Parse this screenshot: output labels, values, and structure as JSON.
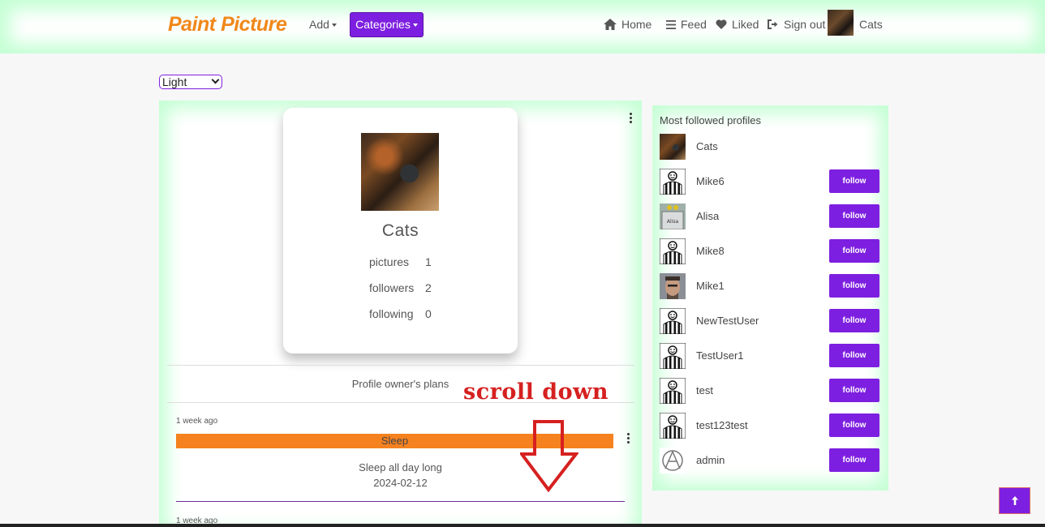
{
  "navbar": {
    "brand": "Paint Picture",
    "add_label": "Add",
    "categories_label": "Categories",
    "home_label": "Home",
    "feed_label": "Feed",
    "liked_label": "Liked",
    "signout_label": "Sign out",
    "user_label": "Cats"
  },
  "theme_select": {
    "selected": "Light"
  },
  "profile": {
    "name": "Cats",
    "stats": [
      {
        "label": "pictures",
        "value": "1"
      },
      {
        "label": "followers",
        "value": "2"
      },
      {
        "label": "following",
        "value": "0"
      }
    ]
  },
  "plans": {
    "title": "Profile owner's plans",
    "items": [
      {
        "time": "1 week ago",
        "title": "Sleep",
        "description": "Sleep all day long",
        "date": "2024-02-12",
        "bar_color": "#f5821f"
      },
      {
        "time": "1 week ago"
      }
    ]
  },
  "overlay": {
    "text": "scroll down",
    "color": "#d62020"
  },
  "sidebar": {
    "title": "Most followed profiles",
    "follow_label": "follow",
    "profiles": [
      {
        "name": "Cats",
        "avatar": "cat-photo",
        "show_follow": false
      },
      {
        "name": "Mike6",
        "avatar": "default-avatar",
        "show_follow": true
      },
      {
        "name": "Alisa",
        "avatar": "alisa-avatar",
        "show_follow": true
      },
      {
        "name": "Mike8",
        "avatar": "default-avatar",
        "show_follow": true
      },
      {
        "name": "Mike1",
        "avatar": "mike1-photo",
        "show_follow": true
      },
      {
        "name": "NewTestUser",
        "avatar": "default-avatar",
        "show_follow": true
      },
      {
        "name": "TestUser1",
        "avatar": "default-avatar",
        "show_follow": true
      },
      {
        "name": "test",
        "avatar": "default-avatar",
        "show_follow": true
      },
      {
        "name": "test123test",
        "avatar": "default-avatar",
        "show_follow": true
      },
      {
        "name": "admin",
        "avatar": "anarchy-avatar",
        "show_follow": true
      }
    ]
  },
  "colors": {
    "accent": "#7d1fe0",
    "brand": "#f0881a",
    "glow": "#c4ffd4"
  }
}
